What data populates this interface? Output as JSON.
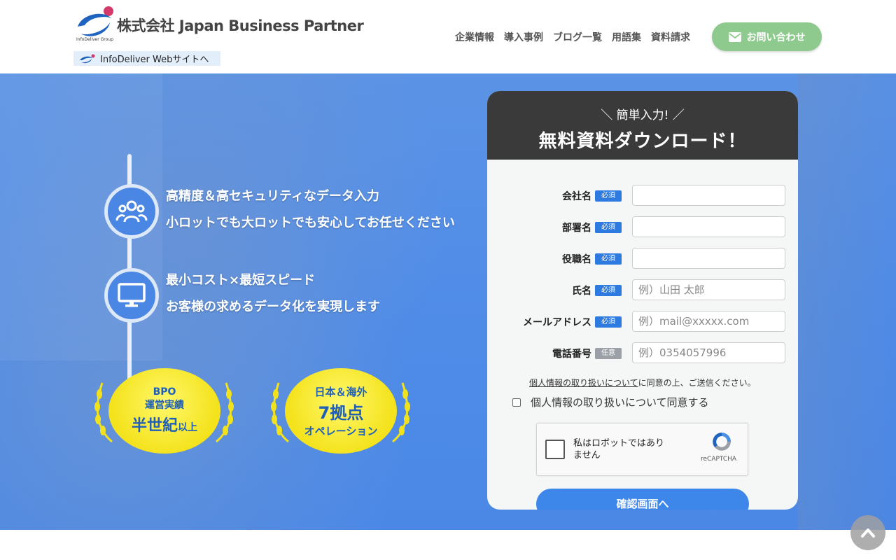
{
  "header": {
    "company_name": "株式会社 Japan Business Partner",
    "group_label": "InfoDeliver Group",
    "sublink_label": "InfoDeliver Webサイトへ",
    "nav": [
      "企業情報",
      "導入事例",
      "ブログ一覧",
      "用語集",
      "資料請求"
    ],
    "contact_label": "お問い合わせ",
    "colors": {
      "contact_bg": "#8ec98d"
    }
  },
  "hero": {
    "features": [
      {
        "icon": "people-icon",
        "line1": "高精度＆高セキュリティなデータ入力",
        "line2": "小ロットでも大ロットでも安心してお任せください"
      },
      {
        "icon": "monitor-icon",
        "line1": "最小コスト×最短スピード",
        "line2": "お客様の求めるデータ化を実現します"
      }
    ],
    "badges": [
      {
        "line1": "BPO",
        "line2": "運営実績",
        "line3": "半世紀",
        "line3_suffix": "以上"
      },
      {
        "line1": "日本＆海外",
        "line2": "7拠点",
        "line3": "オペレーション"
      }
    ]
  },
  "form": {
    "subtitle": "＼ 簡単入力! ／",
    "title": "無料資料ダウンロード！",
    "required_tag": "必須",
    "optional_tag": "任意",
    "fields": [
      {
        "label": "会社名",
        "required": true,
        "placeholder": ""
      },
      {
        "label": "部署名",
        "required": true,
        "placeholder": ""
      },
      {
        "label": "役職名",
        "required": true,
        "placeholder": ""
      },
      {
        "label": "氏名",
        "required": true,
        "placeholder": "例）山田 太郎"
      },
      {
        "label": "メールアドレス",
        "required": true,
        "placeholder": "例）mail@xxxxx.com"
      },
      {
        "label": "電話番号",
        "required": false,
        "placeholder": "例）0354057996"
      }
    ],
    "privacy_link": "個人情報の取り扱いについて",
    "privacy_suffix": "に同意の上、ご送信ください。",
    "agree_label": "個人情報の取り扱いについて同意する",
    "captcha_text": "私はロボットではありません",
    "captcha_brand": "reCAPTCHA",
    "submit_label": "確認画面へ"
  }
}
